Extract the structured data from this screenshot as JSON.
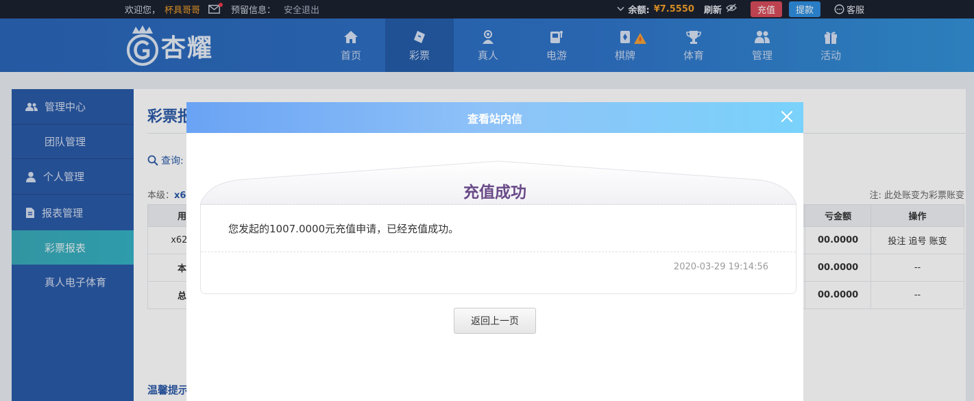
{
  "topbar": {
    "welcome": "欢迎您，",
    "username": "杯具哥哥",
    "reserved_info": "预留信息：",
    "logout": "安全退出",
    "balance_label": "余额:",
    "balance_value": "¥7.5550",
    "refresh": "刷新",
    "recharge": "充值",
    "withdraw": "提款",
    "service": "客服"
  },
  "header": {
    "logo_text": "杏耀",
    "nav": [
      {
        "label": "首页",
        "icon": "home-icon"
      },
      {
        "label": "彩票",
        "icon": "lottery-icon"
      },
      {
        "label": "真人",
        "icon": "live-dealer-icon"
      },
      {
        "label": "电游",
        "icon": "slot-machine-icon"
      },
      {
        "label": "棋牌",
        "icon": "cards-icon"
      },
      {
        "label": "体育",
        "icon": "trophy-icon"
      },
      {
        "label": "管理",
        "icon": "users-icon"
      },
      {
        "label": "活动",
        "icon": "gift-icon"
      }
    ]
  },
  "sidebar": {
    "groups": [
      {
        "label": "管理中心",
        "icon": "users-icon"
      },
      {
        "label": "个人管理",
        "icon": "user-icon"
      },
      {
        "label": "报表管理",
        "icon": "report-icon"
      }
    ],
    "items": [
      "团队管理",
      "彩票报表",
      "真人电子体育"
    ]
  },
  "main": {
    "title": "彩票报",
    "query_label": "查询:",
    "level_label": "本级：",
    "level_value": "x6",
    "note": "注: 此处账变为彩票账变",
    "table": {
      "headers": [
        "用",
        "亏金额",
        "操作"
      ],
      "rows": [
        {
          "c1": "x624",
          "amount": "00.0000",
          "ops": "投注 追号 账变"
        },
        {
          "c1": "本",
          "amount": "00.0000",
          "ops": "--"
        },
        {
          "c1": "总",
          "amount": "00.0000",
          "ops": "--"
        }
      ]
    },
    "tip": "温馨提示"
  },
  "modal": {
    "title": "查看站内信",
    "message_title": "充值成功",
    "message_body": "您发起的1007.0000元充值申请，已经充值成功。",
    "message_time": "2020-03-29 19:14:56",
    "back_button": "返回上一页"
  },
  "colors": {
    "primary_blue": "#2b5aa8",
    "accent_orange": "#f0a02a",
    "recharge_red": "#d84c5a",
    "withdraw_blue": "#2f8fe0",
    "sidebar_active": "#3aa9b8",
    "message_title": "#6a4a88"
  }
}
